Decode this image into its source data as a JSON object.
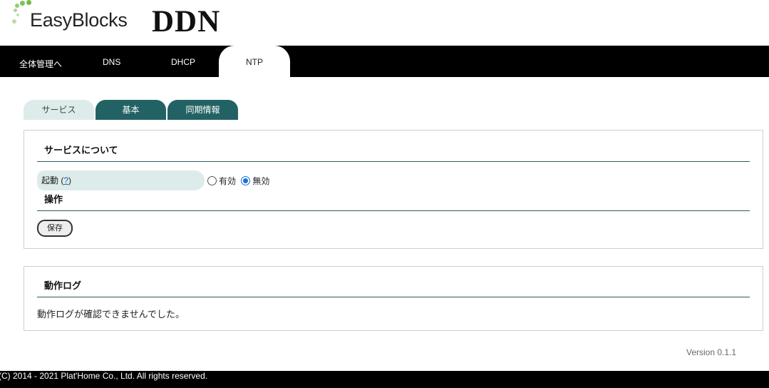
{
  "header": {
    "logo_text": "EasyBlocks",
    "brand": "DDN"
  },
  "nav": {
    "items": [
      {
        "label": "全体管理へ"
      },
      {
        "label": "DNS"
      },
      {
        "label": "DHCP"
      },
      {
        "label": "NTP",
        "active": true
      }
    ]
  },
  "subtabs": [
    {
      "label": "サービス",
      "active": true
    },
    {
      "label": "基本"
    },
    {
      "label": "同期情報"
    }
  ],
  "service": {
    "title": "サービスについて",
    "startup_label": "起動",
    "help_text": "?",
    "options": [
      {
        "label": "有効",
        "checked": false
      },
      {
        "label": "無効",
        "checked": true
      }
    ],
    "operation_title": "操作",
    "save_label": "保存"
  },
  "log": {
    "title": "動作ログ",
    "message": "動作ログが確認できませんでした。"
  },
  "version": "Version 0.1.1",
  "footer": "(C) 2014 - 2021 Plat'Home Co., Ltd. All rights reserved.",
  "colors": {
    "accent_dark": "#236264",
    "accent_light": "#ddecea",
    "logo_green": "#6fbe44"
  }
}
